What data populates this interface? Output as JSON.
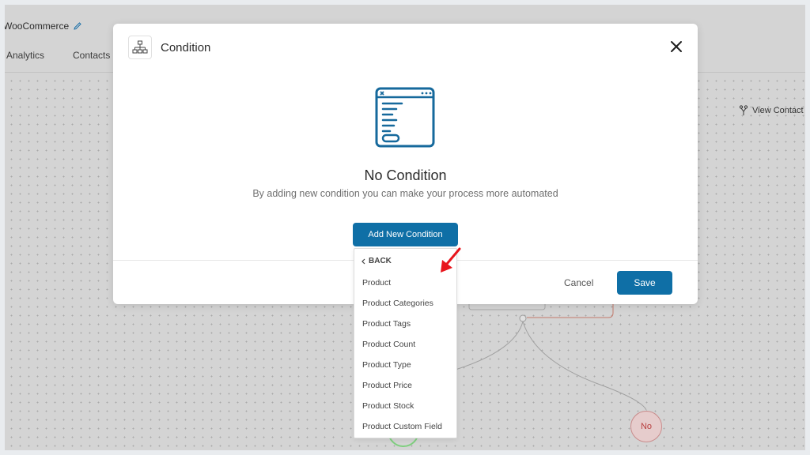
{
  "app": {
    "title": "WooCommerce",
    "tabs": [
      {
        "label": "Analytics"
      },
      {
        "label": "Contacts"
      }
    ],
    "view_contact_label": "View Contact J"
  },
  "flow": {
    "no_node_label": "No"
  },
  "modal": {
    "title": "Condition",
    "empty_title": "No Condition",
    "empty_subtitle": "By adding new condition you can make your process more automated",
    "add_button_label": "Add New Condition",
    "cancel_label": "Cancel",
    "save_label": "Save"
  },
  "dropdown": {
    "back_label": "BACK",
    "items": [
      {
        "label": "Product"
      },
      {
        "label": "Product Categories"
      },
      {
        "label": "Product Tags"
      },
      {
        "label": "Product Count"
      },
      {
        "label": "Product Type"
      },
      {
        "label": "Product Price"
      },
      {
        "label": "Product Stock"
      },
      {
        "label": "Product Custom Field"
      }
    ]
  },
  "colors": {
    "primary": "#0f6fa6",
    "overlay": "#d4d4d4",
    "arrow": "#e8141b",
    "no_node": "#b83f3f"
  }
}
